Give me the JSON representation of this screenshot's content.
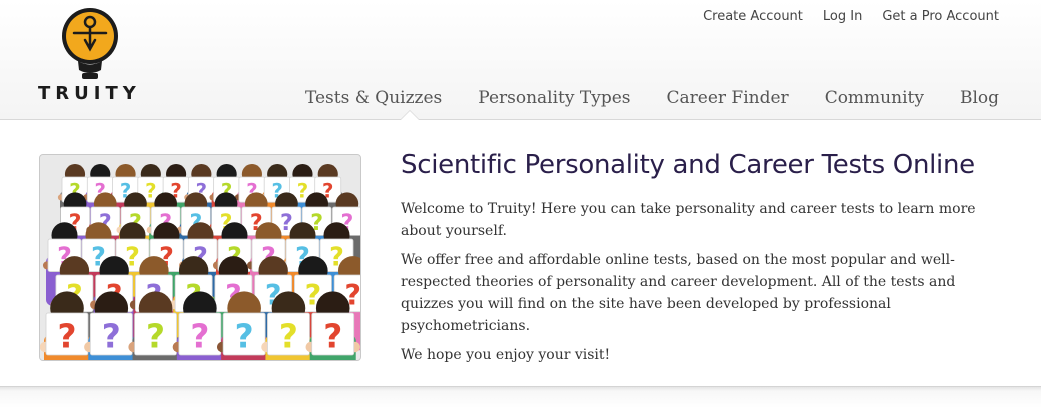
{
  "brand": {
    "name": "TRUITY",
    "logo_color": "#f2a81d"
  },
  "top_links": [
    {
      "label": "Create Account"
    },
    {
      "label": "Log In"
    },
    {
      "label": "Get a Pro Account"
    }
  ],
  "main_nav": [
    {
      "label": "Tests & Quizzes",
      "active": true
    },
    {
      "label": "Personality Types"
    },
    {
      "label": "Career Finder"
    },
    {
      "label": "Community"
    },
    {
      "label": "Blog"
    }
  ],
  "hero": {
    "image_icon": "crowd-with-question-mark-signs",
    "sign_glyph": "?"
  },
  "content": {
    "title": "Scientific Personality and Career Tests Online",
    "paragraphs": [
      "Welcome to Truity! Here you can take personality and career tests to learn more about yourself.",
      "We offer free and affordable online tests, based on the most popular and well-respected theories of personality and career development. All of the tests and quizzes you will find on the site have been developed by professional psychometricians.",
      "We hope you enjoy your visit!"
    ]
  },
  "colors": {
    "title": "#2a1f4a",
    "q_purple": "#8e6fd8",
    "q_red": "#e2452f",
    "q_yellow": "#e3df2a",
    "q_blue": "#56bfe4",
    "q_pink": "#e46fd1",
    "q_green": "#b5d92a"
  }
}
